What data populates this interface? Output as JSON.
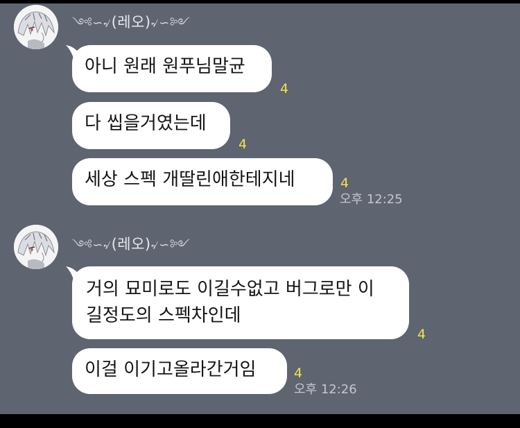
{
  "colors": {
    "background": "#5e6470",
    "bubble": "#ffffff",
    "read_count": "#f2e44b",
    "timestamp": "#c3c7ce"
  },
  "groups": [
    {
      "sender": {
        "deco_left": "༺∽৵",
        "name": "(레오)",
        "deco_right": "৵∽༻",
        "avatar_icon": "anime-character-avatar"
      },
      "messages": [
        {
          "text": "아니 원래 원푸님말균",
          "read": "4",
          "time": ""
        },
        {
          "text": "다 씹을거였는데",
          "read": "4",
          "time": ""
        },
        {
          "text": "세상 스펙 개딸린애한테지네",
          "read": "4",
          "time": "오후 12:25"
        }
      ]
    },
    {
      "sender": {
        "deco_left": "༺∽৵",
        "name": "(레오)",
        "deco_right": "৵∽༻",
        "avatar_icon": "anime-character-avatar"
      },
      "messages": [
        {
          "text": "거의 묘미로도 이길수없고 버그로만 이 길정도의 스펙차인데",
          "read": "4",
          "time": ""
        },
        {
          "text": "이걸 이기고올라간거임",
          "read": "4",
          "time": "오후 12:26"
        }
      ]
    }
  ]
}
